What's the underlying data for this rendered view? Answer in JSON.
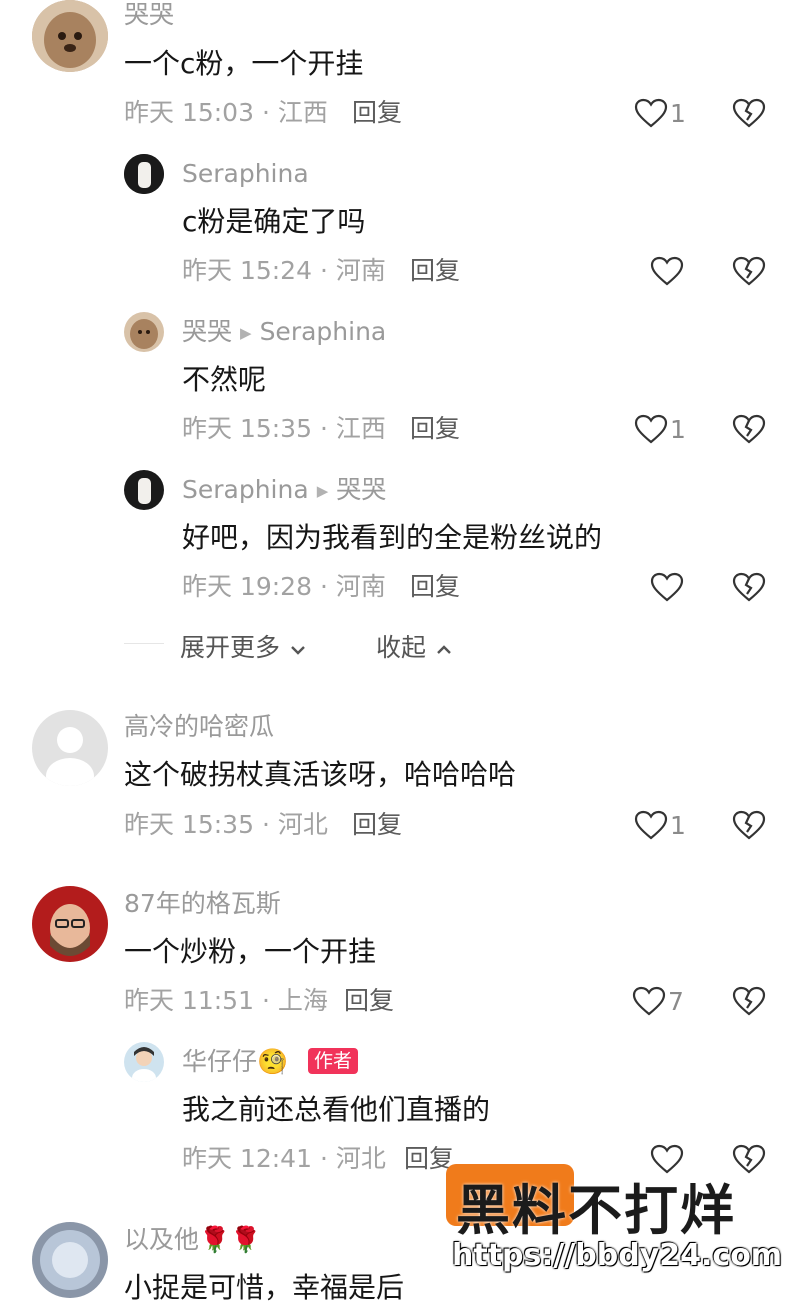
{
  "comments": [
    {
      "user": "哭哭",
      "text": "一个c粉，一个开挂",
      "meta": "昨天 15:03 · 江西",
      "reply": "回复",
      "likes": "1",
      "replies": [
        {
          "user": "Seraphina",
          "reply_to": "",
          "text": "c粉是确定了吗",
          "meta": "昨天 15:24 · 河南",
          "reply": "回复",
          "likes": ""
        },
        {
          "user": "哭哭",
          "reply_to": "Seraphina",
          "text": "不然呢",
          "meta": "昨天 15:35 · 江西",
          "reply": "回复",
          "likes": "1"
        },
        {
          "user": "Seraphina",
          "reply_to": "哭哭",
          "text": "好吧，因为我看到的全是粉丝说的",
          "meta": "昨天 19:28 · 河南",
          "reply": "回复",
          "likes": ""
        }
      ],
      "expand_more": "展开更多",
      "collapse": "收起"
    },
    {
      "user": "高冷的哈密瓜",
      "text": "这个破拐杖真活该呀，哈哈哈哈",
      "meta": "昨天 15:35 · 河北",
      "reply": "回复",
      "likes": "1"
    },
    {
      "user": "87年的格瓦斯",
      "text": "一个炒粉，一个开挂",
      "meta": "昨天 11:51 · 上海",
      "reply": "回复",
      "likes": "7",
      "replies": [
        {
          "user": "华仔仔",
          "emoji": "🧐",
          "badge": "作者",
          "text": "我之前还总看他们直播的",
          "meta": "昨天 12:41 · 河北",
          "reply": "回复",
          "likes": ""
        }
      ]
    },
    {
      "user": "以及他",
      "emoji": "🌹🌹",
      "text": "小捉是可惜，幸福是后"
    }
  ],
  "watermark": {
    "logo": "黑料不打烊",
    "url": "https://bbdy24.com"
  },
  "colors": {
    "badge": "#f1335a",
    "meta": "#a2a2a2",
    "name": "#9a9a9a"
  }
}
